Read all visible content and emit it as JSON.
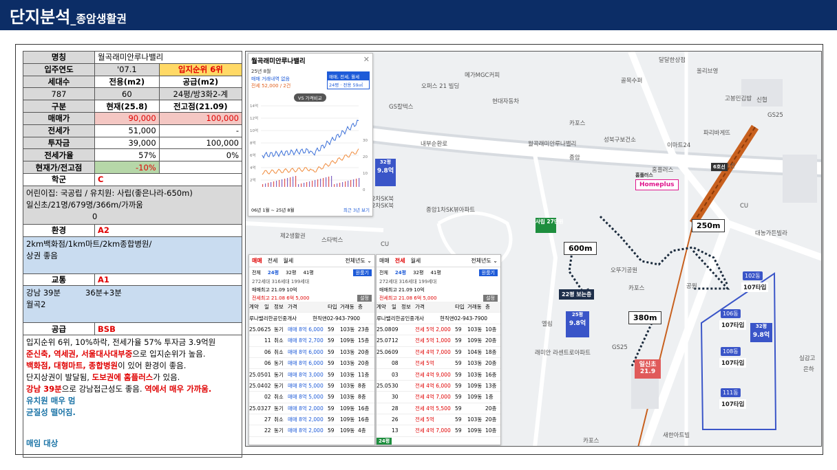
{
  "header": {
    "title": "단지분석",
    "subtitle": "_종암생활권"
  },
  "info": {
    "name_label": "명칭",
    "name": "월곡래미안루나밸리",
    "year_label": "입주연도",
    "year": "'07.1",
    "rank": "입지순위 6위",
    "units_label": "세대수",
    "excl_label": "전용(m2)",
    "supply_label": "공급(m2)",
    "units": "787",
    "excl": "60",
    "supply": "24평/방3화2-계",
    "col_label": "구분",
    "cur_label": "현재(25.8)",
    "peak_label": "전고점(21.09)",
    "sale_label": "매매가",
    "sale_cur": "90,000",
    "sale_peak": "100,000",
    "jeonse_label": "전세가",
    "jeonse_cur": "51,000",
    "jeonse_peak": "-",
    "gap_label": "투자금",
    "gap_cur": "39,000",
    "gap_peak": "100,000",
    "ratio_label": "전세가율",
    "ratio_cur": "57%",
    "ratio_peak": "0%",
    "vs_label": "현재가/전고점",
    "vs_val": "-10%"
  },
  "school": {
    "label": "학군",
    "grade": "C",
    "line1": "어린이집: 국공립 / 유치원: 사립(좋은나라-650m)",
    "line2": "일신초/21명/679명/366m/가까움",
    "line3": "0"
  },
  "env": {
    "label": "환경",
    "grade": "A2",
    "line1": "2km백화점/1km마트/2km종합병원/",
    "line2": "상권 좋음"
  },
  "traffic": {
    "label": "교통",
    "grade": "A1",
    "line1a": "강남 39분",
    "line1b": "36분+3분",
    "line2": "월곡2"
  },
  "supply": {
    "label": "공급",
    "grade": "BSB",
    "l1": "입지순위 6위, 10%하락, 전세가율 57% 투자금 3.9억원",
    "l2a": "준신축, 역세권, 서울대사대부중",
    "l2b": "으로 입지순위가 높음.",
    "l3a": "백화점, 대형마트, 종합병원",
    "l3b": "이 있어 환경이 좋음.",
    "l4a": "단지상권이 발달됨, ",
    "l4b": "도보권에 홈플러스",
    "l4c": "가 있음.",
    "l5a": "강남 39분",
    "l5b": "으로 강남접근성도 좋음. ",
    "l5c": "역에서 매우 가까움.",
    "l6": "유치원 매우 멈",
    "l7": "균질성 떨어짐.",
    "l8": "매임 대상"
  },
  "chart_panel": {
    "title": "월곡래미안루나밸리",
    "month": "25년 8월",
    "deal": "매매 거래내역 없음",
    "jeonse": "전세 52,000 / 2건",
    "filter": "매매, 전세, 월세",
    "size": "24평 · 전용 59㎡",
    "compare": "VS 가격비교",
    "range": "06년 1월 ~ 25년 8월",
    "recent": "최근 3년 보기",
    "y_left": [
      "14억",
      "12억",
      "10억",
      "8억",
      "6억",
      "4억",
      "2억"
    ],
    "y_right": [
      "30",
      "20",
      "10",
      "0"
    ]
  },
  "deal_panel1": {
    "tabs": [
      "매매",
      "전세",
      "월세"
    ],
    "period": "전체년도",
    "sizes": [
      "전체",
      "24평",
      "32평",
      "41평"
    ],
    "counts": [
      "272세대",
      "316세대",
      "199세대"
    ],
    "peak": "매매최고 21.09 10억",
    "latest": "전세최고 21.08 6억 5,000",
    "button": "원룸기",
    "button2": "설정",
    "cols": [
      "계약",
      "일",
      "정보",
      "가격",
      "타입",
      "거래동",
      "층"
    ],
    "agent1": "루나밸리한공인중개사",
    "agent2": "현직앤02-943-7900",
    "rows": [
      [
        "25.06",
        "25",
        "동기",
        "매매 8억 6,000",
        "59",
        "103동",
        "23층"
      ],
      [
        "",
        "11",
        "취소",
        "매매 8억 2,700",
        "59",
        "109동",
        "15층"
      ],
      [
        "",
        "06",
        "취소",
        "매매 8억 6,000",
        "59",
        "103동",
        "20층"
      ],
      [
        "",
        "06",
        "동기",
        "매매 8억 6,000",
        "59",
        "103동",
        "20층"
      ],
      [
        "25.05",
        "01",
        "동기",
        "매매 8억 3,000",
        "59",
        "103동",
        "11층"
      ],
      [
        "25.04",
        "02",
        "동기",
        "매매 8억 5,000",
        "59",
        "103동",
        "8층"
      ],
      [
        "",
        "02",
        "취소",
        "매매 8억 5,000",
        "59",
        "103동",
        "8층"
      ],
      [
        "25.03",
        "27",
        "동기",
        "매매 8억 2,000",
        "59",
        "109동",
        "16층"
      ],
      [
        "",
        "27",
        "취소",
        "매매 8억 2,000",
        "59",
        "109동",
        "16층"
      ],
      [
        "",
        "22",
        "동기",
        "매매 8억 2,000",
        "59",
        "109동",
        "4층"
      ]
    ]
  },
  "deal_panel2": {
    "tabs": [
      "매매",
      "전세",
      "월세"
    ],
    "period": "전체년도",
    "sizes": [
      "전체",
      "24평",
      "32평",
      "41평"
    ],
    "counts": [
      "272세대",
      "316세대",
      "199세대"
    ],
    "peak": "매매최고 21.09 10억",
    "latest": "전세최고 21.08 6억 5,000",
    "button": "원룸기",
    "button2": "설정",
    "cols": [
      "계약",
      "일",
      "정보",
      "가격",
      "타입",
      "거래동",
      "층"
    ],
    "agent1": "루나밸리한공인중개사",
    "agent2": "현직앤02-943-7900",
    "rows": [
      [
        "25.08",
        "09",
        "",
        "전세 5억 2,000",
        "59",
        "103동",
        "10층"
      ],
      [
        "25.07",
        "12",
        "",
        "전세 5억 1,000",
        "59",
        "109동",
        "20층"
      ],
      [
        "25.06",
        "09",
        "",
        "전세 4억 7,000",
        "59",
        "104동",
        "18층"
      ],
      [
        "",
        "08",
        "",
        "전세 5억",
        "59",
        "103동",
        "20층"
      ],
      [
        "",
        "03",
        "",
        "전세 4억 9,000",
        "59",
        "103동",
        "16층"
      ],
      [
        "25.05",
        "30",
        "",
        "전세 4억 6,000",
        "59",
        "109동",
        "13층"
      ],
      [
        "",
        "30",
        "",
        "전세 4억 7,000",
        "59",
        "109동",
        "1층"
      ],
      [
        "",
        "28",
        "",
        "전세 4억 5,500",
        "59",
        "",
        "20층"
      ],
      [
        "",
        "26",
        "",
        "전세 5억",
        "59",
        "103동",
        "20층"
      ],
      [
        "",
        "13",
        "",
        "전세 4억 7,000",
        "59",
        "109동",
        "10층"
      ]
    ]
  },
  "map": {
    "labels": [
      "달달한상점",
      "올리브영",
      "메가MGC커피",
      "골목수퍼",
      "오퍼스 21 빌딩",
      "고봉민김밥",
      "신협",
      "현대자동차",
      "카포스",
      "파리바게뜨",
      "GS칼텍스",
      "GS25",
      "내부순환로",
      "이마트24",
      "성북구보건소",
      "종암",
      "홈플러스",
      "6호선",
      "월곡래미안루나밸리",
      "2차SK북",
      "종암1차SK뷰아파트",
      "2차SK북",
      "대농가든빌라",
      "CU",
      "제2생활권",
      "스타벅스",
      "CU",
      "오뚜기공원",
      "공원",
      "엘림",
      "래미안 라센트로아파트",
      "GS25",
      "카포스",
      "공원",
      "카포스",
      "새한아트빌",
      "실감고",
      "은하"
    ],
    "school_tag": "사립 27만원",
    "gyms": "22평 보는층",
    "dist1": "600m",
    "dist2": "250m",
    "dist3": "380m",
    "price1_size": "32평",
    "price1": "9.8억",
    "price2_size": "25평",
    "price2": "9.8억",
    "ilsin": "일신초",
    "ilsin_val": "21.9",
    "homeplus": "Homeplus",
    "dongs": [
      "102동",
      "106동",
      "108동",
      "111동"
    ],
    "types": [
      "107타입",
      "107타입",
      "107타입",
      "107타입"
    ],
    "complex_price_size": "32평",
    "complex_price": "9.8억",
    "sub_badge": "24평"
  },
  "colors": {
    "header": "#0c2d66",
    "map_blue": "#3a55c8",
    "accent_red": "#e00000"
  }
}
